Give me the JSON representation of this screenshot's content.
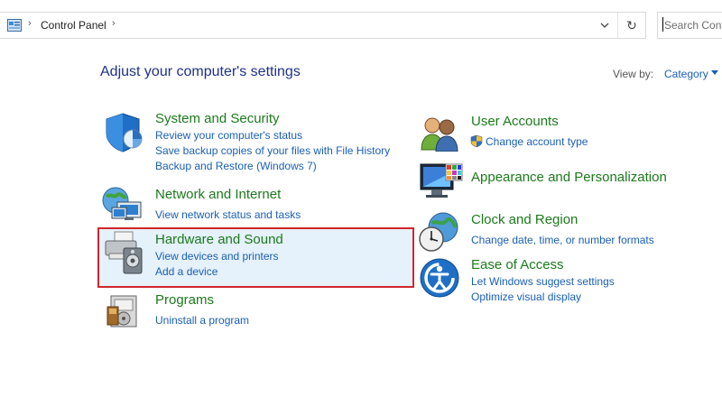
{
  "address_bar": {
    "breadcrumb": "Control Panel",
    "search_placeholder": "Search Cont"
  },
  "heading": "Adjust your computer's settings",
  "view_by": {
    "label": "View by:",
    "value": "Category"
  },
  "categories": {
    "system_security": {
      "title": "System and Security",
      "links": [
        "Review your computer's status",
        "Save backup copies of your files with File History",
        "Backup and Restore (Windows 7)"
      ]
    },
    "network": {
      "title": "Network and Internet",
      "links": [
        "View network status and tasks"
      ]
    },
    "hardware": {
      "title": "Hardware and Sound",
      "links": [
        "View devices and printers",
        "Add a device"
      ]
    },
    "programs": {
      "title": "Programs",
      "links": [
        "Uninstall a program"
      ]
    },
    "user_accounts": {
      "title": "User Accounts",
      "links": [
        "Change account type"
      ]
    },
    "appearance": {
      "title": "Appearance and Personalization",
      "links": []
    },
    "clock": {
      "title": "Clock and Region",
      "links": [
        "Change date, time, or number formats"
      ]
    },
    "ease": {
      "title": "Ease of Access",
      "links": [
        "Let Windows suggest settings",
        "Optimize visual display"
      ]
    }
  },
  "colors": {
    "title_green": "#1c7a1c",
    "link_blue": "#1a5fb4",
    "heading_blue": "#1e3287",
    "highlight_border": "#d0262f",
    "highlight_fill": "#e5f1fb"
  },
  "icons": [
    "control-panel-icon",
    "shield-icon",
    "network-globe-icon",
    "printer-icon",
    "programs-icon",
    "users-icon",
    "uac-shield-icon",
    "monitor-palette-icon",
    "clock-globe-icon",
    "ease-of-access-icon",
    "refresh-icon",
    "chevron-down-icon"
  ]
}
